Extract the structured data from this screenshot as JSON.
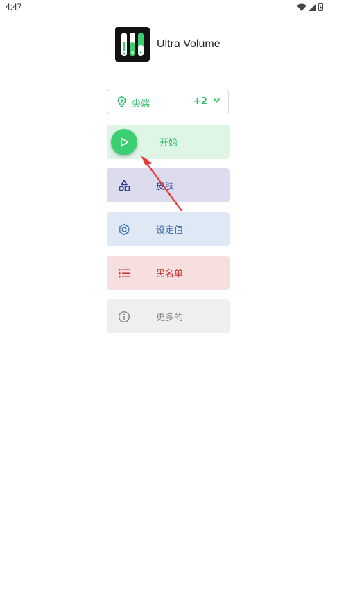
{
  "status_bar": {
    "time": "4:47",
    "icons": [
      "wifi-icon",
      "signal-icon",
      "battery-icon"
    ]
  },
  "header": {
    "app_name": "Ultra Volume",
    "logo_icon": "volume-sliders-logo"
  },
  "mode_select": {
    "icon": "lightbulb-icon",
    "label": "尖端",
    "extra": "+2",
    "chevron": "chevron-down-icon"
  },
  "menu": [
    {
      "label": "开始",
      "icon": "play-icon",
      "color": "#2ebd64",
      "bg": "#dff5e6"
    },
    {
      "label": "皮肤",
      "icon": "shapes-icon",
      "color": "#2d3a8c",
      "bg": "#dcdcee"
    },
    {
      "label": "设定值",
      "icon": "gear-icon",
      "color": "#3d6fa8",
      "bg": "#dfe9f6"
    },
    {
      "label": "黑名单",
      "icon": "list-icon",
      "color": "#cc3a3a",
      "bg": "#f7dfe0"
    },
    {
      "label": "更多的",
      "icon": "info-icon",
      "color": "#8a8a8a",
      "bg": "#efefef"
    }
  ],
  "colors": {
    "accent": "#3ccf72",
    "annotation_arrow": "#e53935"
  }
}
